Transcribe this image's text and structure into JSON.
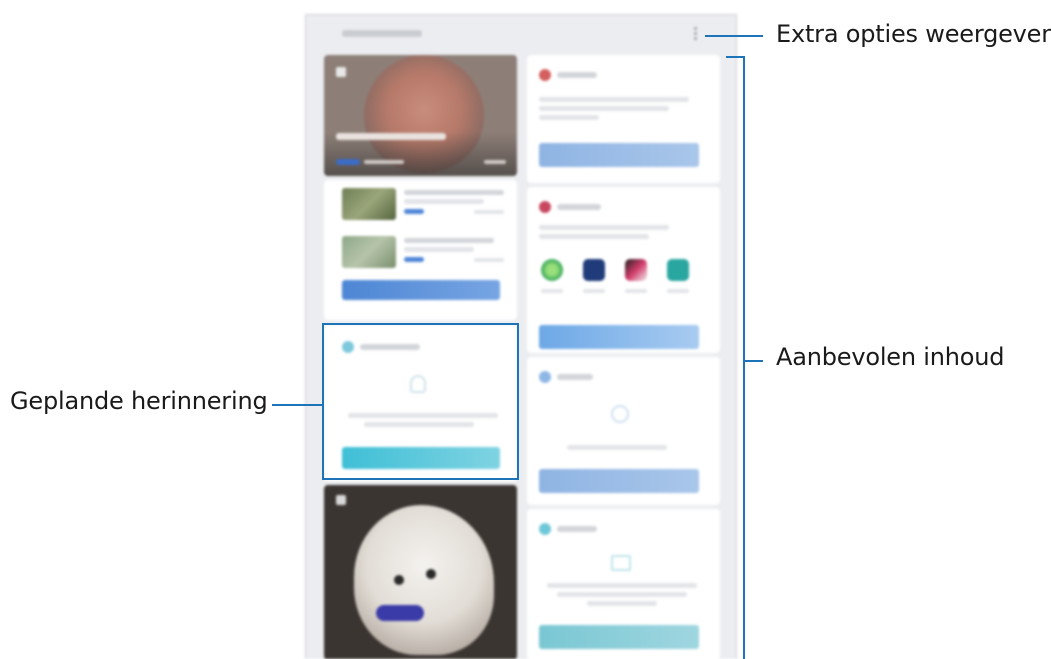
{
  "callouts": {
    "extra_options": "Extra opties weergeven.",
    "recommended_content": "Aanbevolen inhoud",
    "scheduled_reminder": "Geplande herinnering"
  },
  "colors": {
    "leader_line": "#1e74b8",
    "highlight_frame": "#1e74b8",
    "screen_background": "#ecedf0"
  },
  "screen": {
    "more_options_icon": "vertical-ellipsis-icon",
    "cards": [
      {
        "name": "video-card",
        "icon": "video-icon"
      },
      {
        "name": "news-list-card",
        "icon": "news-icon"
      },
      {
        "name": "scheduled-reminder-card",
        "icon": "bell-icon"
      },
      {
        "name": "photo-card",
        "icon": "photo-icon"
      },
      {
        "name": "recommendation-card-1",
        "icon": "app-icon"
      },
      {
        "name": "app-suggestion-card",
        "icon": "apps-icon"
      },
      {
        "name": "recommendation-card-3",
        "icon": "clock-icon"
      },
      {
        "name": "recommendation-card-4",
        "icon": "screen-icon"
      }
    ]
  }
}
